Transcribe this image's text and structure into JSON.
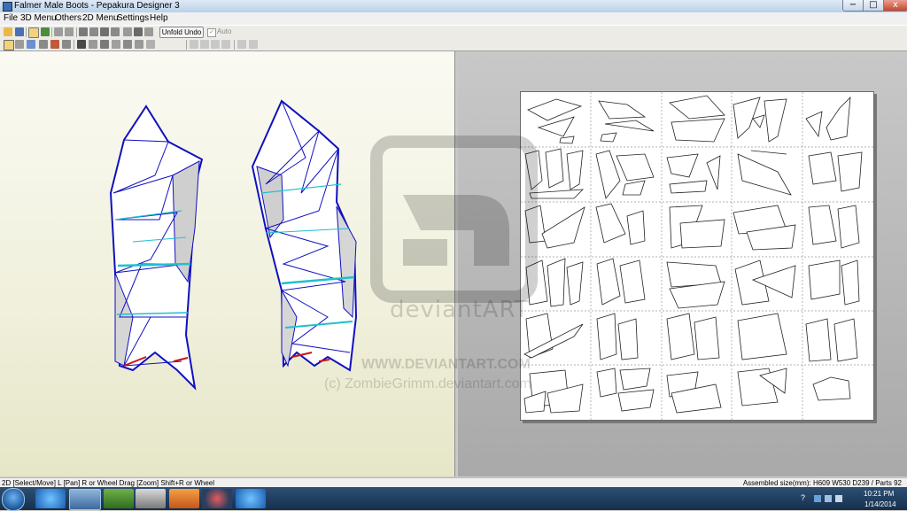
{
  "window": {
    "title": "Falmer Male Boots - Pepakura Designer 3",
    "minimize_icon": "−",
    "maximize_icon": "□",
    "close_icon": "x"
  },
  "menu": {
    "items": [
      "File",
      "3D Menu",
      "Others",
      "2D Menu",
      "Settings",
      "Help"
    ]
  },
  "toolbar": {
    "unfold_undo_label": "Unfold Undo",
    "auto_label": "Auto",
    "auto_checked": true
  },
  "watermark": {
    "brand": "deviantART",
    "url": "WWW.DEVIANTART.COM",
    "credit": "(c) ZombieGrimm.deviantart.com"
  },
  "status": {
    "left": "2D [Select/Move] L [Pan] R or Wheel Drag [Zoom] Shift+R or Wheel",
    "right": "Assembled size(mm): H609 W530 D239 / Parts 92"
  },
  "taskbar": {
    "apps": [
      "internet-explorer",
      "virtualbox",
      "terminal",
      "windows-explorer",
      "media-player",
      "pepakura",
      "internet-explorer-2"
    ],
    "time": "10:21 PM",
    "date": "1/14/2014"
  },
  "colors": {
    "model_edge": "#1010c0",
    "fold_line": "#20c0d0",
    "cut_edge": "#d01010"
  }
}
